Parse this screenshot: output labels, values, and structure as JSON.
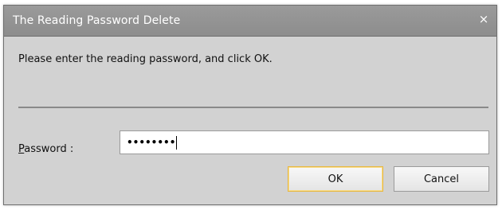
{
  "window": {
    "title": "The Reading Password Delete",
    "close_glyph": "×"
  },
  "message": "Please enter the reading password, and click OK.",
  "password": {
    "label_accel": "P",
    "label_rest": "assword :",
    "masked_value": "••••••••"
  },
  "buttons": {
    "ok_label": "OK",
    "cancel_label": "Cancel"
  },
  "colors": {
    "titlebar": "#949494",
    "dialog_bg": "#d2d2d2",
    "default_button_border": "#e8b83f"
  }
}
